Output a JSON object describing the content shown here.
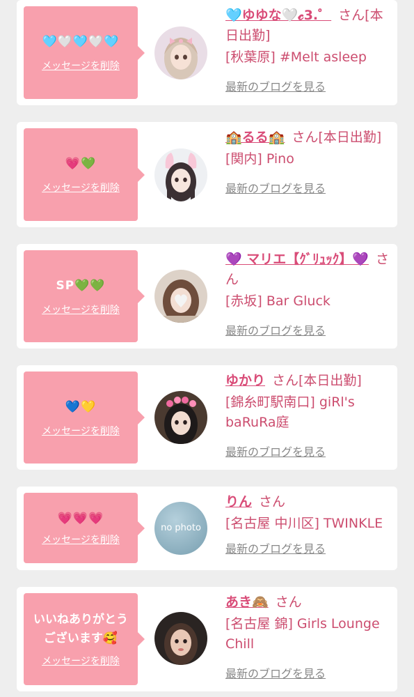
{
  "colors": {
    "page_bg": "#eeeeee",
    "card_bg": "#ffffff",
    "bubble_pink": "#f8a0ad",
    "name_pink": "#d94c78",
    "text_pink": "#cc4d6f",
    "link_gray": "#888888"
  },
  "common": {
    "delete_label": "メッセージを削除",
    "blog_label": "最新のブログを見る",
    "san": "さん"
  },
  "messages": [
    {
      "stamp": "🩵🤍🩵🤍🩵",
      "name": "🩵ゆゆな🤍𝓬3.゜",
      "suffix": "さん[本日出勤]",
      "shop": "[秋葉原] #Melt asleep",
      "avatar_icon": "avatar-girl-pink-bow"
    },
    {
      "stamp": "💗💚",
      "name": "🏫るる🏫",
      "suffix": "さん[本日出勤]",
      "shop": "[関内] Pino",
      "avatar_icon": "avatar-girl-bunny-ears"
    },
    {
      "stamp": "SP💚💚",
      "name": "💜 マリエ【ｸﾞﾘｭｯｸ】💜",
      "suffix": "さん",
      "shop": "[赤坂] Bar Gluck",
      "avatar_icon": "avatar-girl-heart-face"
    },
    {
      "stamp": "💙💛",
      "name": "ゆかり",
      "suffix": "さん[本日出勤]",
      "shop": "[錦糸町駅南口] giRl's baRuRa庭",
      "avatar_icon": "avatar-girl-flower-crown"
    },
    {
      "stamp": "💗💗💗",
      "name": "りん",
      "suffix": "さん",
      "shop": "[名古屋 中川区] TWINKLE",
      "avatar_icon": "avatar-no-photo",
      "avatar_text": "no photo"
    },
    {
      "stamp": "いいねありがとうございます🥰",
      "name": "あき🙈",
      "suffix": "さん",
      "shop": "[名古屋 錦] Girls Lounge Chill",
      "avatar_icon": "avatar-girl-selfie"
    }
  ]
}
